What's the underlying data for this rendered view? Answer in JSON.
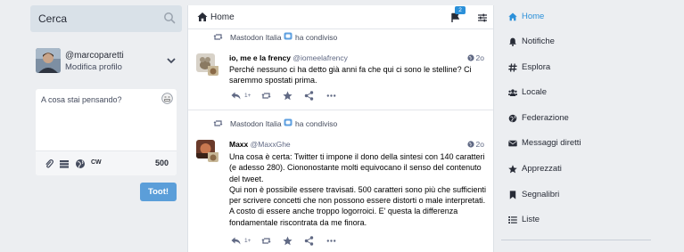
{
  "search": {
    "placeholder": "Cerca"
  },
  "account": {
    "username": "@marcoparetti",
    "edit_label": "Modifica profilo"
  },
  "compose": {
    "placeholder": "A cosa stai pensando?",
    "cw_label": "CW",
    "char_count": "500",
    "toot_label": "Toot!"
  },
  "column": {
    "title": "Home",
    "notification_badge": "2",
    "statuses": [
      {
        "booster": "Mastodon Italia",
        "boost_verb": "ha condiviso",
        "display_name": "io, me e la frency",
        "handle": "@iomeelafrency",
        "time": "2o",
        "content": "Perché nessuno ci ha detto già anni fa che qui ci sono le stelline? Ci saremmo spostati prima.",
        "reply_count": "1+"
      },
      {
        "booster": "Mastodon Italia",
        "boost_verb": "ha condiviso",
        "display_name": "Maxx",
        "handle": "@MaxxGhe",
        "time": "2o",
        "content": "Una cosa è certa: Twitter ti impone il dono della sintesi con 140 caratteri\n(e adesso 280). Ciononostante molti equivocano il senso del contenuto\ndel tweet.\nQui non è possibile essere travisati. 500 caratteri sono più che sufficienti\nper scrivere concetti che non possono essere distorti o male interpretati.\nA costo di essere anche troppo logorroici. E' questa la differenza\nfondamentale riscontrata da me finora.",
        "reply_count": "1+"
      }
    ]
  },
  "nav": {
    "items": [
      {
        "label": "Home",
        "icon": "home-icon",
        "active": true
      },
      {
        "label": "Notifiche",
        "icon": "bell-icon"
      },
      {
        "label": "Esplora",
        "icon": "hashtag-icon"
      },
      {
        "label": "Locale",
        "icon": "users-icon"
      },
      {
        "label": "Federazione",
        "icon": "globe-icon"
      },
      {
        "label": "Messaggi diretti",
        "icon": "envelope-icon"
      },
      {
        "label": "Apprezzati",
        "icon": "star-icon"
      },
      {
        "label": "Segnalibri",
        "icon": "bookmark-icon"
      },
      {
        "label": "Liste",
        "icon": "list-icon"
      }
    ]
  },
  "colors": {
    "accent": "#2b90d9",
    "button": "#5b9ed9",
    "background": "#eceef1",
    "search_bg": "#d9e1e8"
  }
}
